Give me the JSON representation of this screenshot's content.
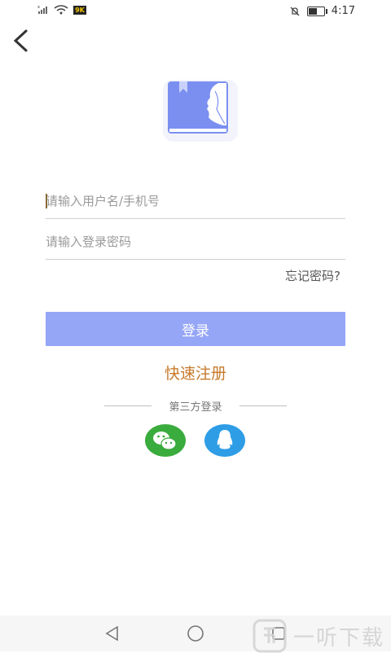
{
  "status_bar": {
    "left_badge": "9K",
    "time": "4:17",
    "battery_level": 0.55
  },
  "icons": {
    "back": "chevron-left-icon",
    "logo": "book-woman-profile-logo",
    "wechat": "wechat-icon",
    "qq": "qq-penguin-icon"
  },
  "login": {
    "username_placeholder": "请输入用户名/手机号",
    "password_placeholder": "请输入登录密码",
    "forgot_label": "忘记密码?",
    "submit_label": "登录",
    "register_label": "快速注册",
    "third_party_label": "第三方登录"
  },
  "watermark": {
    "text": "一听下载"
  },
  "colors": {
    "primary_button": "#96a6f6",
    "register_text": "#c87a2c",
    "wechat_green": "#3aab3d",
    "qq_blue": "#2e9de6",
    "logo_blue": "#7b8ff1"
  }
}
